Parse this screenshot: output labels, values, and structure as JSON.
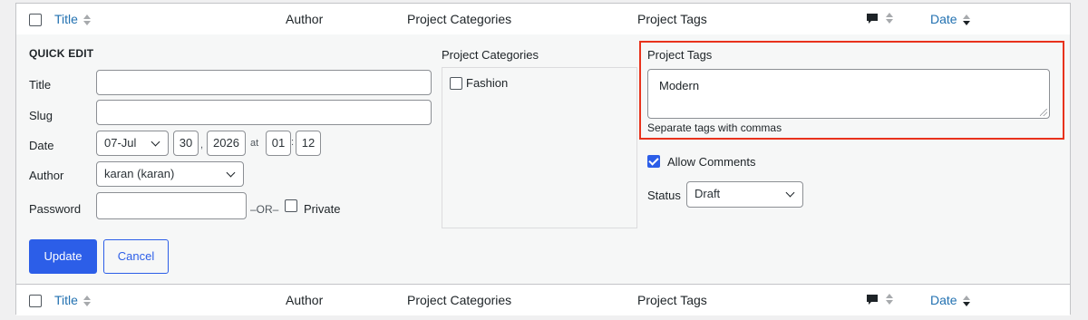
{
  "header": {
    "title": "Title",
    "author": "Author",
    "categories": "Project Categories",
    "tags": "Project Tags",
    "date": "Date"
  },
  "footer": {
    "title": "Title",
    "author": "Author",
    "categories": "Project Categories",
    "tags": "Project Tags",
    "date": "Date"
  },
  "quick_edit": {
    "heading": "QUICK EDIT",
    "title_label": "Title",
    "title_value": "",
    "slug_label": "Slug",
    "slug_value": "",
    "date_label": "Date",
    "month": "07-Jul",
    "day": "30",
    "comma": ",",
    "year": "2026",
    "at": "at",
    "hour": "01",
    "colon": ":",
    "minute": "12",
    "author_label": "Author",
    "author_value": "karan (karan)",
    "password_label": "Password",
    "password_value": "",
    "or_text": "–OR–",
    "private_label": "Private",
    "private_checked": false,
    "update_button": "Update",
    "cancel_button": "Cancel",
    "categories_label": "Project Categories",
    "categories": [
      {
        "label": "Fashion",
        "checked": false
      }
    ],
    "tags_label": "Project Tags",
    "tags_value": "Modern",
    "tags_hint": "Separate tags with commas",
    "allow_comments_label": "Allow Comments",
    "allow_comments_checked": true,
    "status_label": "Status",
    "status_value": "Draft"
  },
  "colors": {
    "link": "#2271b1",
    "primary": "#2c5ee8",
    "highlight": "#e8321c"
  },
  "icons": {
    "comments": "comment-bubble-icon",
    "sort": "sort-indicator-icon",
    "select": "chevron-down-icon",
    "resize": "resize-handle-icon"
  }
}
